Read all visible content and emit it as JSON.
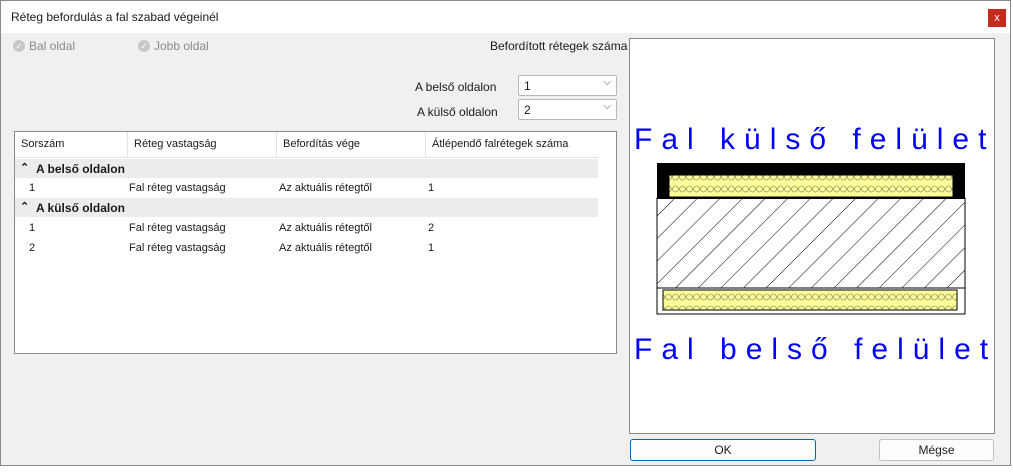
{
  "window": {
    "title": "Réteg befordulás a fal szabad végeinél",
    "close_label": "x"
  },
  "checkboxes": {
    "left": "Bal oldal",
    "right": "Jobb oldal"
  },
  "section_title": "Befordított rétegek száma",
  "inner": {
    "label": "A belső oldalon",
    "value": "1"
  },
  "outer": {
    "label": "A külső oldalon",
    "value": "2"
  },
  "table": {
    "columns": [
      "Sorszám",
      "Réteg vastagság",
      "Befordítás vége",
      "Átlépendő falrétegek száma"
    ],
    "groups": [
      {
        "label": "A belső oldalon",
        "rows": [
          [
            "1",
            "Fal réteg vastagság",
            "Az aktuális rétegtől",
            "1"
          ]
        ]
      },
      {
        "label": "A külső oldalon",
        "rows": [
          [
            "1",
            "Fal réteg vastagság",
            "Az aktuális rétegtől",
            "2"
          ],
          [
            "2",
            "Fal réteg vastagság",
            "Az aktuális rétegtől",
            "1"
          ]
        ]
      }
    ]
  },
  "preview": {
    "top_text": "Fal külső felület",
    "bottom_text": "Fal belső felület",
    "text_color": "#0000ff"
  },
  "buttons": {
    "ok": "OK",
    "cancel": "Mégse"
  },
  "icons": {
    "group": "collapse-up-icon",
    "chevron": "chevron-down-icon",
    "check": "check-icon"
  }
}
